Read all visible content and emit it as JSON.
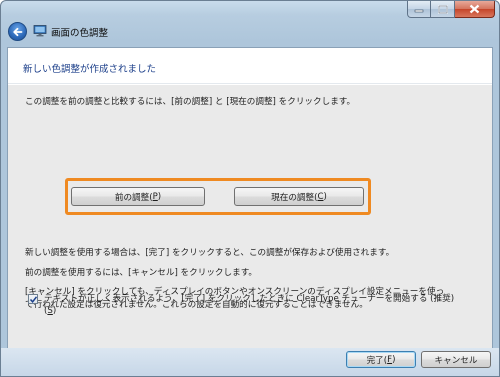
{
  "window": {
    "title": "画面の色調整",
    "controls": {
      "minimize": "minimize-icon",
      "maximize": "maximize-icon",
      "close": "close-icon"
    }
  },
  "banner": {
    "heading": "新しい色調整が作成されました"
  },
  "main": {
    "compare_text": "この調整を前の調整と比較するには、[前の調整] と [現在の調整] をクリックします。",
    "previous_button": "前の調整(",
    "previous_button_key": "P",
    "previous_button_end": ")",
    "current_button": "現在の調整(",
    "current_button_key": "C",
    "current_button_end": ")",
    "para1": "新しい調整を使用する場合は、[完了] をクリックすると、この調整が保存および使用されます。",
    "para2": "前の調整を使用するには、[キャンセル] をクリックします。",
    "para3_line1": "[キャンセル] をクリックしても、ディスプレイのボタンやオンスクリーンのディスプレイ設定メニューを使っ",
    "para3_line2": "て行われた設定は復元されません。これらの設定を自動的に復元することはできません。",
    "checkbox_line1": "テキストが正しく表示されるよう、[完了] をクリックしたときに ClearType チューナーを開始する (推奨)",
    "checkbox_line2_key": "S",
    "checkbox_checked": true
  },
  "footer": {
    "finish_button": "完了(",
    "finish_key": "F",
    "finish_end": ")",
    "cancel_button": "キャンセル"
  },
  "colors": {
    "highlight_border": "#ef8a22",
    "banner_text": "#1c3f8a",
    "body_bg": "#eaeaea"
  }
}
